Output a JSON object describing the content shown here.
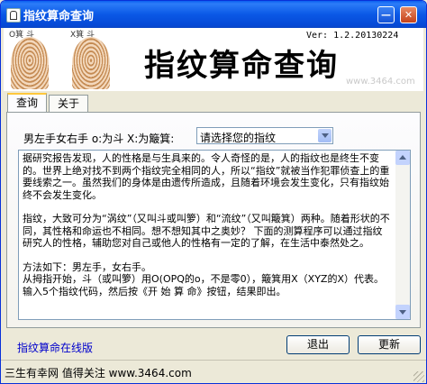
{
  "window": {
    "title": "指纹算命查询",
    "minimize_glyph": "—",
    "close_glyph": "✕"
  },
  "header": {
    "fingerprint_left_label": "O箕 斗",
    "fingerprint_right_label": "X箕 斗",
    "version": "Ver: 1.2.20130224",
    "big_title": "指纹算命查询",
    "watermark": "www.3464.com"
  },
  "tabs": [
    {
      "label": "查询",
      "active": true
    },
    {
      "label": "关于",
      "active": false
    }
  ],
  "form": {
    "hand_label": "男左手女右手  o:为斗 X:为簸箕:",
    "select_value": "请选择您的指纹"
  },
  "description": {
    "para1": "据研究报告发现，人的性格是与生具来的。令人奇怪的是，人的指纹也是终生不变的。世界上绝对找不到两个指纹完全相同的人，所以“指纹”就被当作犯罪侦查上的重要线索之一。虽然我们的身体是由遗传所造成，且随着环境会发生变化，只有指纹始终不会发生变化。",
    "para2": "指纹，大致可分为“涡纹”（又叫斗或叫箩）和“流纹”（又叫簸箕）两种。随着形状的不同，其性格和命运也不相同。想不想知其中之奥妙？ 下面的测算程序可以通过指纹研究人的性格，辅助您对自己或他人的性格有一定的了解，在生活中泰然处之。",
    "para3": "方法如下：男左手，女右手。",
    "para4": "从拇指开始，斗（或叫箩）用O(OPQ的o，不是零0），簸箕用X（XYZ的X）代表。输入5个指纹代码，然后按《开 始 算 命》按钮，结果即出。"
  },
  "footer": {
    "online_link": "指纹算命在线版",
    "exit_button": "退出",
    "refresh_button": "更新",
    "status_text": "三生有幸网 值得关注 www.3464.com"
  },
  "colors": {
    "titlebar": "#0a58e6",
    "link": "#0000cc",
    "tab_highlight": "#ffc83c"
  }
}
